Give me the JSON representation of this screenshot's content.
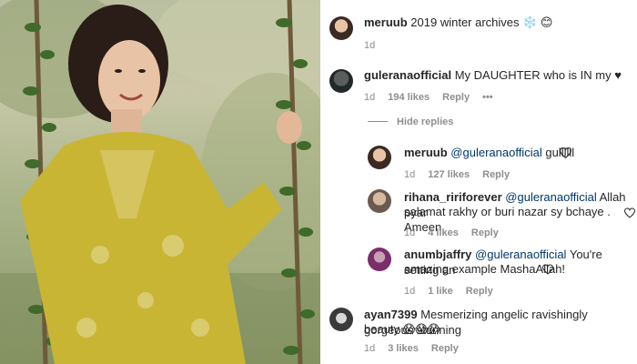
{
  "post": {
    "caption_user": "meruub",
    "caption_text": "2019 winter archives ❄️ 😊",
    "caption_time": "1d"
  },
  "comments": [
    {
      "user": "guleranaofficial",
      "text": "My DAUGHTER who is IN my ♥",
      "time": "1d",
      "likes": "194 likes",
      "reply": "Reply",
      "more": "•••"
    }
  ],
  "hide_replies": "Hide replies",
  "replies": [
    {
      "user": "meruub",
      "mention": "@guleranaofficial",
      "text": "gullllll",
      "time": "1d",
      "likes": "127 likes",
      "reply": "Reply"
    },
    {
      "user": "rihana_ririforever",
      "mention": "@guleranaofficial",
      "line1": "Allah pyar",
      "line2": "salamat rakhy or buri nazar sy bchaye . Ameen",
      "time": "1d",
      "likes": "4 likes",
      "reply": "Reply"
    },
    {
      "user": "anumbjaffry",
      "mention": "@guleranaofficial",
      "line1": "You're setting an",
      "line2": "amazing example MashaAllah!",
      "time": "1d",
      "likes": "1 like",
      "reply": "Reply"
    }
  ],
  "last_comment": {
    "user": "ayan7399",
    "line1": "Mesmerizing angelic ravishingly gorgeous stunning",
    "line2": "beauty 😱😱😱",
    "time": "1d",
    "likes": "3 likes",
    "reply": "Reply"
  },
  "icons": {
    "heart": "heart-outline-icon",
    "more": "more-options-icon"
  },
  "colors": {
    "mention": "#00376b",
    "meta": "#8e8e8e",
    "dress": "#c9b534"
  }
}
